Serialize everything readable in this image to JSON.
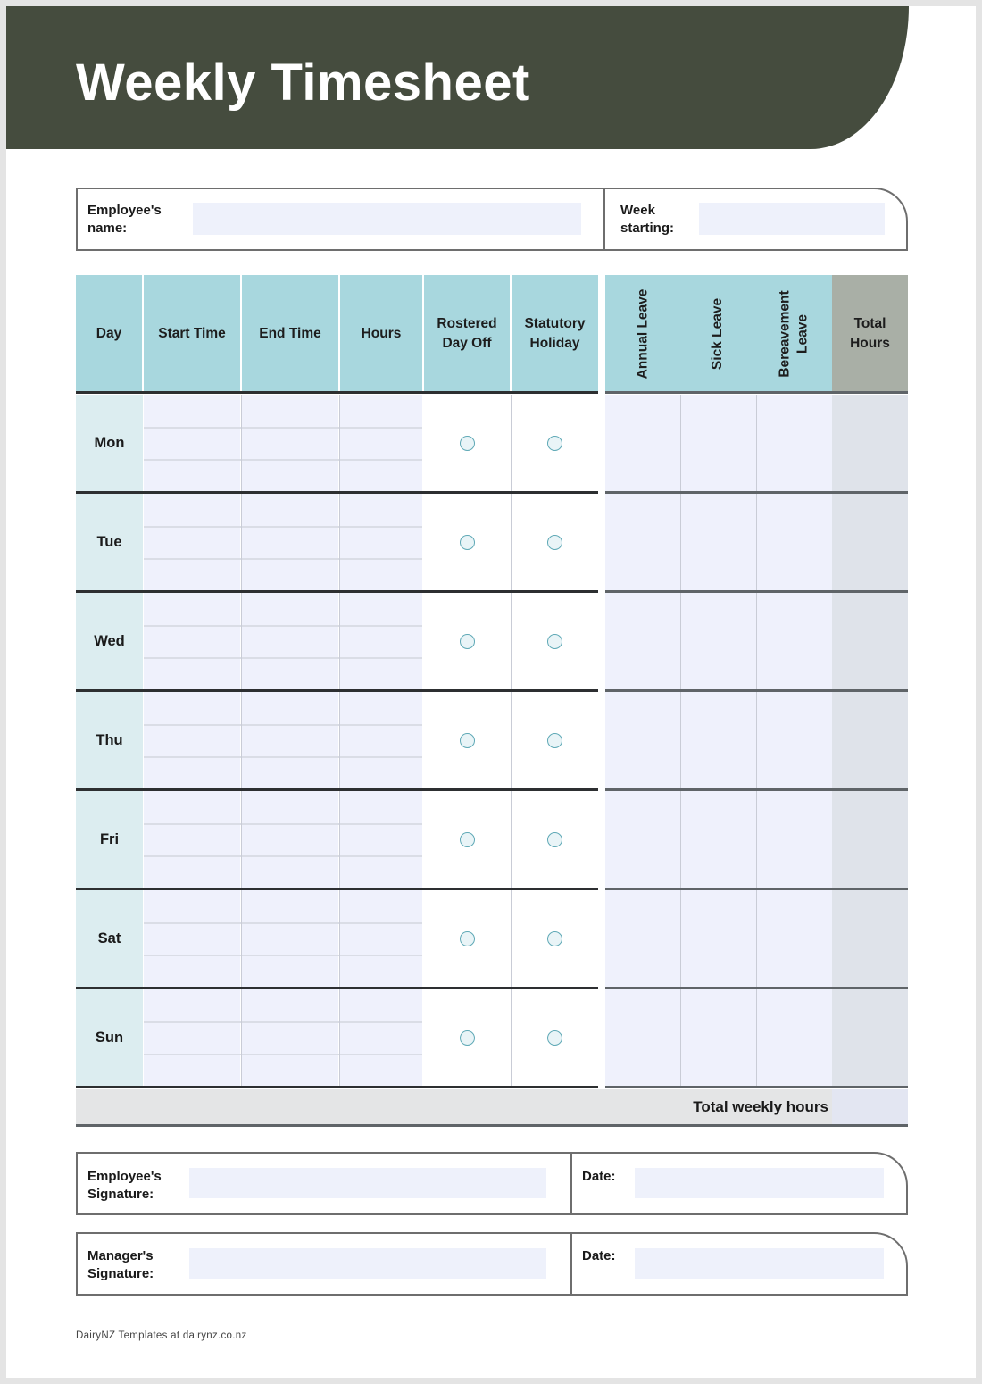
{
  "header": {
    "title": "Weekly Timesheet"
  },
  "info": {
    "employee_name_label": "Employee's\nname:",
    "employee_name_value": "",
    "week_starting_label": "Week\nstarting:",
    "week_starting_value": ""
  },
  "table": {
    "columns": {
      "day": "Day",
      "start_time": "Start Time",
      "end_time": "End Time",
      "hours": "Hours",
      "rostered_day_off": "Rostered Day Off",
      "statutory_holiday": "Statutory Holiday",
      "annual_leave": "Annual Leave",
      "sick_leave": "Sick Leave",
      "bereavement_leave": "Bereavement Leave",
      "total_hours": "Total Hours"
    },
    "days": [
      {
        "label": "Mon",
        "rostered_day_off": false,
        "statutory_holiday": false
      },
      {
        "label": "Tue",
        "rostered_day_off": false,
        "statutory_holiday": false
      },
      {
        "label": "Wed",
        "rostered_day_off": false,
        "statutory_holiday": false
      },
      {
        "label": "Thu",
        "rostered_day_off": false,
        "statutory_holiday": false
      },
      {
        "label": "Fri",
        "rostered_day_off": false,
        "statutory_holiday": false
      },
      {
        "label": "Sat",
        "rostered_day_off": false,
        "statutory_holiday": false
      },
      {
        "label": "Sun",
        "rostered_day_off": false,
        "statutory_holiday": false
      }
    ],
    "total_weekly_hours_label": "Total weekly hours",
    "total_weekly_hours_value": ""
  },
  "signatures": {
    "employee_signature_label": "Employee's\nSignature:",
    "employee_date_label": "Date:",
    "manager_signature_label": "Manager's\nSignature:",
    "manager_date_label": "Date:"
  },
  "footer": {
    "text": "DairyNZ Templates at dairynz.co.nz"
  },
  "colors": {
    "header_bg": "#454c3e",
    "table_header_bg": "#a8d7de",
    "total_header_bg": "#a9afa6",
    "day_cell_bg": "#dcedf0",
    "input_bg": "#eff1fc",
    "radio_border": "#5fa9b6"
  }
}
